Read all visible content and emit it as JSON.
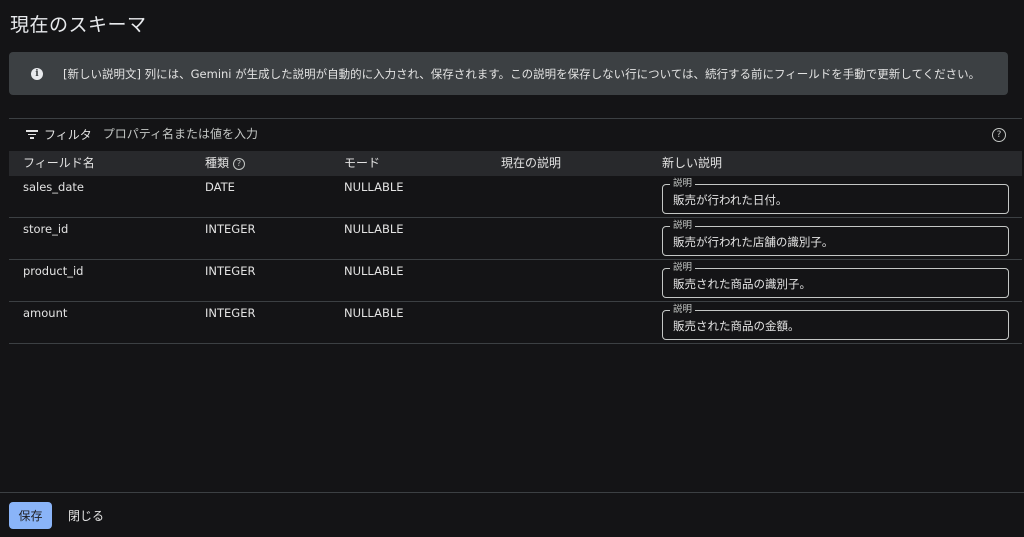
{
  "page": {
    "title": "現在のスキーマ"
  },
  "banner": {
    "icon": "info-icon",
    "text": "[新しい説明文] 列には、Gemini が生成した説明が自動的に入力され、保存されます。この説明を保存しない行については、続行する前にフィールドを手動で更新してください。"
  },
  "filter": {
    "icon": "filter-icon",
    "label": "フィルタ",
    "placeholder": "プロパティ名または値を入力",
    "help_icon": "help-icon"
  },
  "table": {
    "headers": {
      "field_name": "フィールド名",
      "type": "種類",
      "mode": "モード",
      "current_description": "現在の説明",
      "new_description": "新しい説明"
    },
    "description_legend": "説明",
    "rows": [
      {
        "field_name": "sales_date",
        "type": "DATE",
        "mode": "NULLABLE",
        "current_description": "",
        "new_description": "販売が行われた日付。"
      },
      {
        "field_name": "store_id",
        "type": "INTEGER",
        "mode": "NULLABLE",
        "current_description": "",
        "new_description": "販売が行われた店舗の識別子。"
      },
      {
        "field_name": "product_id",
        "type": "INTEGER",
        "mode": "NULLABLE",
        "current_description": "",
        "new_description": "販売された商品の識別子。"
      },
      {
        "field_name": "amount",
        "type": "INTEGER",
        "mode": "NULLABLE",
        "current_description": "",
        "new_description": "販売された商品の金額。"
      }
    ]
  },
  "footer": {
    "save_label": "保存",
    "close_label": "閉じる"
  },
  "colors": {
    "background": "#141416",
    "banner": "#3c4043",
    "header": "#28292c",
    "primary_button": "#8ab4f8"
  }
}
